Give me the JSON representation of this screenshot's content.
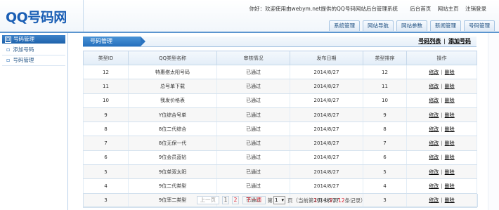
{
  "logo": "QQ号码网",
  "top": {
    "welcome": "你好：欢迎使用由webym.net提供的QQ号码网站后台管理系统",
    "links": [
      "后台首页",
      "网站主页",
      "注销登录"
    ]
  },
  "tabs": [
    "系统管理",
    "网站导航",
    "网站参数",
    "新闻管理",
    "号码管理"
  ],
  "sidebar": {
    "header": "号码管理",
    "toggle": "⊟",
    "items": [
      {
        "label": "添加号码"
      },
      {
        "label": "号码管理"
      }
    ]
  },
  "panel": {
    "title": "号码管理",
    "link_list": "号码列表",
    "link_add": "添加号码",
    "sep": "|"
  },
  "table": {
    "headers": [
      "类型ID",
      "QQ类型名称",
      "审核情况",
      "发布日期",
      "类型排序",
      "操作"
    ],
    "rows": [
      {
        "id": "12",
        "name": "特惠搭太阳号码",
        "status": "已通过",
        "date": "2014/8/27",
        "order": "12",
        "edit": "修改",
        "del": "删除"
      },
      {
        "id": "11",
        "name": "总号单下载",
        "status": "已通过",
        "date": "2014/8/27",
        "order": "11",
        "edit": "修改",
        "del": "删除"
      },
      {
        "id": "10",
        "name": "我发价格表",
        "status": "已通过",
        "date": "2014/8/27",
        "order": "10",
        "edit": "修改",
        "del": "删除"
      },
      {
        "id": "9",
        "name": "Y位综合号单",
        "status": "已通过",
        "date": "2014/8/27",
        "order": "9",
        "edit": "修改",
        "del": "删除"
      },
      {
        "id": "8",
        "name": "8位二代综合",
        "status": "已通过",
        "date": "2014/8/27",
        "order": "8",
        "edit": "修改",
        "del": "删除"
      },
      {
        "id": "7",
        "name": "8位无保一代",
        "status": "已通过",
        "date": "2014/8/27",
        "order": "7",
        "edit": "修改",
        "del": "删除"
      },
      {
        "id": "6",
        "name": "9位会员蓝钻",
        "status": "已通过",
        "date": "2014/8/27",
        "order": "6",
        "edit": "修改",
        "del": "删除"
      },
      {
        "id": "5",
        "name": "9位单双太阳",
        "status": "已通过",
        "date": "2014/8/27",
        "order": "5",
        "edit": "修改",
        "del": "删除"
      },
      {
        "id": "4",
        "name": "9位二代类型",
        "status": "已通过",
        "date": "2014/8/27",
        "order": "4",
        "edit": "修改",
        "del": "删除"
      },
      {
        "id": "3",
        "name": "9位率二类型",
        "status": "已通过",
        "date": "2014/8/27",
        "order": "3",
        "edit": "修改",
        "del": "删除"
      }
    ]
  },
  "pager": {
    "prev": "上一页",
    "page1": "1",
    "page2": "2",
    "next": "下一页",
    "go_prefix": "第",
    "select_value": "1",
    "go_suffix": "页（当前第",
    "current": "1",
    "mid1": "页 共",
    "total_pages": "2",
    "mid2": "页",
    "total_records": "12",
    "suffix": "条记录）"
  },
  "colors": {
    "brand_blue": "#1b5fb5",
    "header_accent": "#5b95cf",
    "approved_green": "#16a112",
    "page_red": "#d23"
  }
}
